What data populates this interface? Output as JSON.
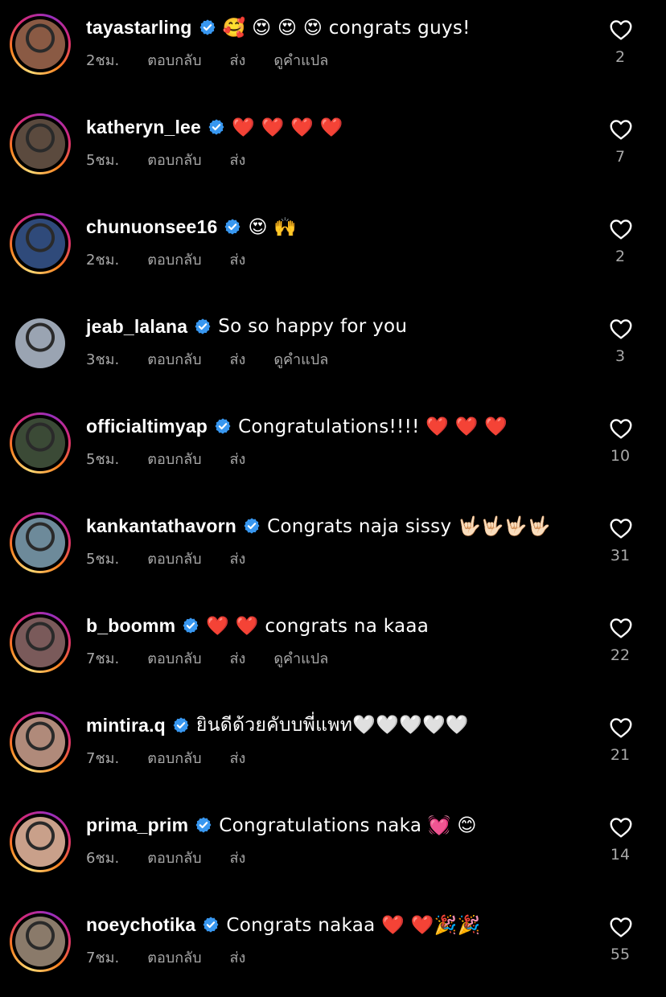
{
  "labels": {
    "reply": "ตอบกลับ",
    "send": "ส่ง",
    "translate": "ดูคำแปล"
  },
  "icons": {
    "verified": "verified-badge-icon",
    "like": "heart-outline-icon"
  },
  "colors": {
    "verified": "#3897f0",
    "muted": "#a8a8a8",
    "background": "#000000"
  },
  "comments": [
    {
      "username": "tayastarling",
      "text": "🥰 😍 😍 😍  congrats guys!",
      "time": "2ชม.",
      "translate": true,
      "likes": "2",
      "story": true
    },
    {
      "username": "katheryn_lee",
      "text": "❤️ ❤️ ❤️ ❤️",
      "time": "5ชม.",
      "translate": false,
      "likes": "7",
      "story": true
    },
    {
      "username": "chunuonsee16",
      "text": "😍  🙌",
      "time": "2ชม.",
      "translate": false,
      "likes": "2",
      "story": true
    },
    {
      "username": "jeab_lalana",
      "text": "So so happy for you",
      "time": "3ชม.",
      "translate": true,
      "likes": "3",
      "story": false
    },
    {
      "username": "officialtimyap",
      "text": "Congratulations!!!!  ❤️ ❤️ ❤️",
      "time": "5ชม.",
      "translate": false,
      "likes": "10",
      "story": true
    },
    {
      "username": "kankantathavorn",
      "text": "Congrats naja sissy 🤟🏻🤟🏻🤟🏻🤟🏻",
      "time": "5ชม.",
      "translate": false,
      "likes": "31",
      "story": true
    },
    {
      "username": "b_boomm",
      "text": "❤️ ❤️  congrats na kaaa",
      "time": "7ชม.",
      "translate": true,
      "likes": "22",
      "story": true
    },
    {
      "username": "mintira.q",
      "text": "ยินดีด้วยคับบพี่แพท🤍🤍🤍🤍🤍",
      "time": "7ชม.",
      "translate": false,
      "likes": "21",
      "story": true
    },
    {
      "username": "prima_prim",
      "text": "Congratulations naka 💓 😊",
      "time": "6ชม.",
      "translate": false,
      "likes": "14",
      "story": true
    },
    {
      "username": "noeychotika",
      "text": "Congrats nakaa ❤️ ❤️🎉🎉",
      "time": "7ชม.",
      "translate": false,
      "likes": "55",
      "story": true
    }
  ]
}
